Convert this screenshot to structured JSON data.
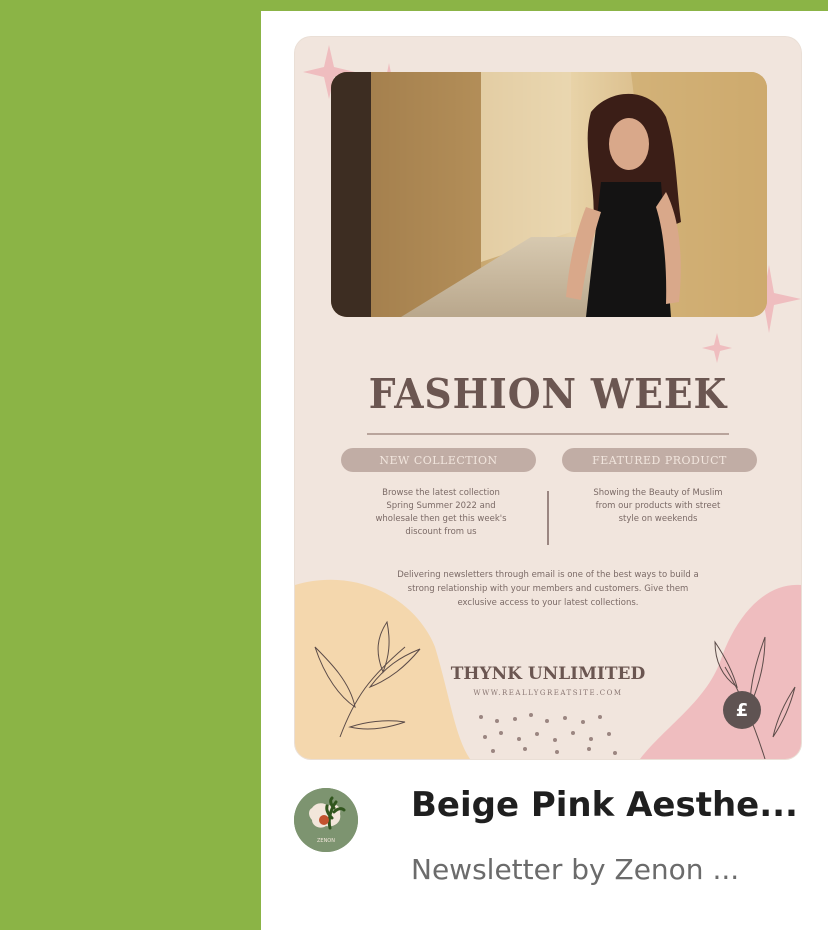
{
  "template": {
    "headline": "FASHION WEEK",
    "tag_left": "NEW COLLECTION",
    "tag_right": "FEATURED PRODUCT",
    "left_text_lines": [
      "Browse the latest collection",
      "Spring Summer 2022 and",
      "wholesale then get this week's",
      "discount from us"
    ],
    "right_text_lines": [
      "Showing the Beauty of Muslim",
      "from our products with street",
      "style on weekends"
    ],
    "body_lines": [
      "Delivering newsletters through email is one of the best ways to build a",
      "strong relationship with your members and customers. Give them",
      "exclusive access to your latest collections."
    ],
    "brand": "THYNK UNLIMITED",
    "brand_url": "WWW.REALLYGREATSITE.COM",
    "badge_symbol": "£",
    "avatar_caption": "ZENON"
  },
  "card": {
    "title": "Beige Pink Aesthe...",
    "subtitle": "Newsletter by Zenon ..."
  },
  "colors": {
    "page_background": "#8bb446",
    "template_background": "#f1e5dd",
    "accent_pink": "#efbdbf",
    "accent_beige": "#f4d7ad",
    "text_brown": "#6b5651"
  }
}
